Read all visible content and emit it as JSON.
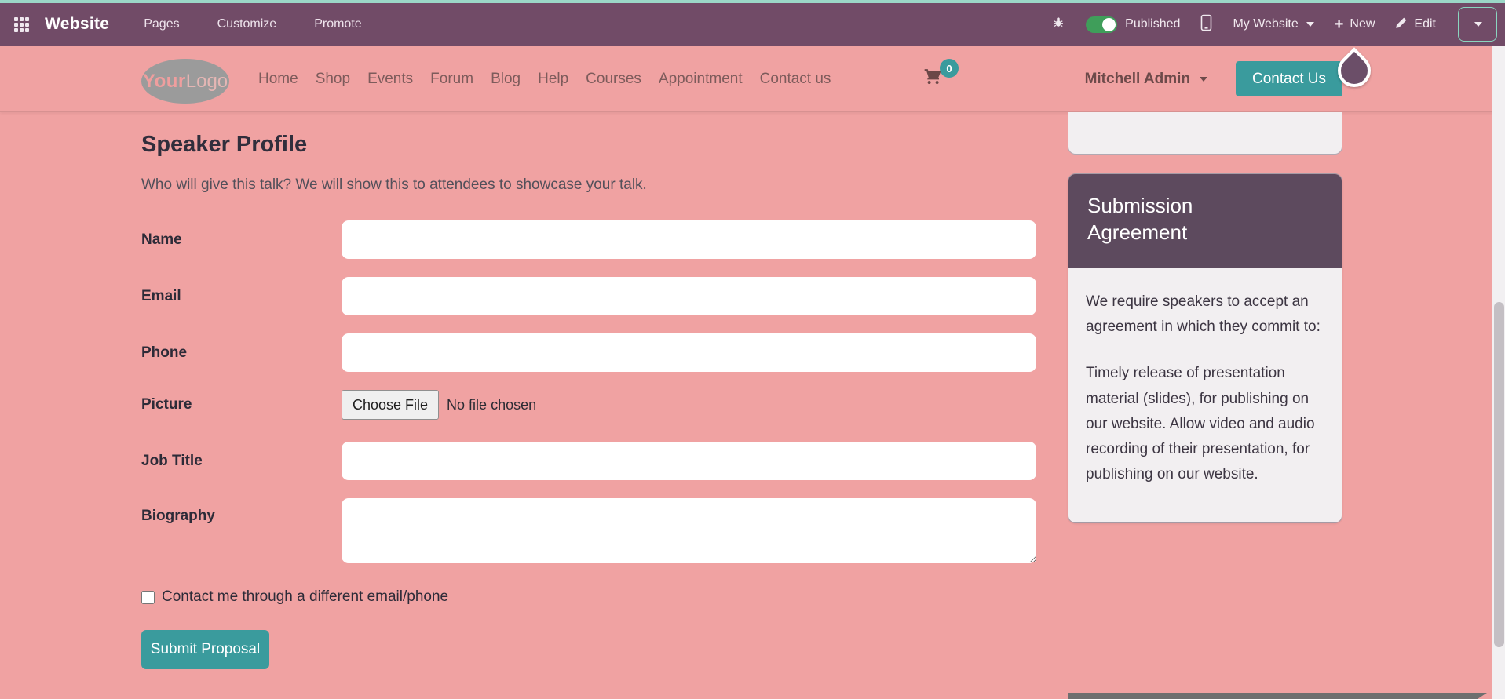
{
  "topbar": {
    "brand": "Website",
    "menu": [
      "Pages",
      "Customize",
      "Promote"
    ],
    "published_label": "Published",
    "site_switcher": "My Website",
    "new_label": "New",
    "edit_label": "Edit"
  },
  "site_nav": {
    "logo_your": "Your",
    "logo_logo": "Logo",
    "items": [
      "Home",
      "Shop",
      "Events",
      "Forum",
      "Blog",
      "Help",
      "Courses",
      "Appointment",
      "Contact us"
    ],
    "cart_count": "0",
    "user_name": "Mitchell Admin",
    "contact_button": "Contact Us"
  },
  "form": {
    "title": "Speaker Profile",
    "subtitle": "Who will give this talk? We will show this to attendees to showcase your talk.",
    "field_labels": [
      "Name",
      "Email",
      "Phone",
      "Picture",
      "Job Title",
      "Biography"
    ],
    "file_button": "Choose File",
    "file_status": "No file chosen",
    "checkbox_label": "Contact me through a different email/phone",
    "submit_button": "Submit Proposal"
  },
  "sidebar": {
    "agreement_title": "Submission Agreement",
    "agreement_intro": "We require speakers to accept an agreement in which they commit to:",
    "agreement_body": "Timely release of presentation material (slides), for publishing on our website. Allow video and audio recording of their presentation, for publishing on our website."
  },
  "colors": {
    "accent_teal": "#3a9b9d",
    "topbar_purple": "#714b67",
    "page_pink": "#f0a2a2",
    "sidebar_header_purple": "#5d4a5e",
    "toggle_green": "#3f9e5a",
    "top_strip_teal": "#9bd7c7"
  }
}
